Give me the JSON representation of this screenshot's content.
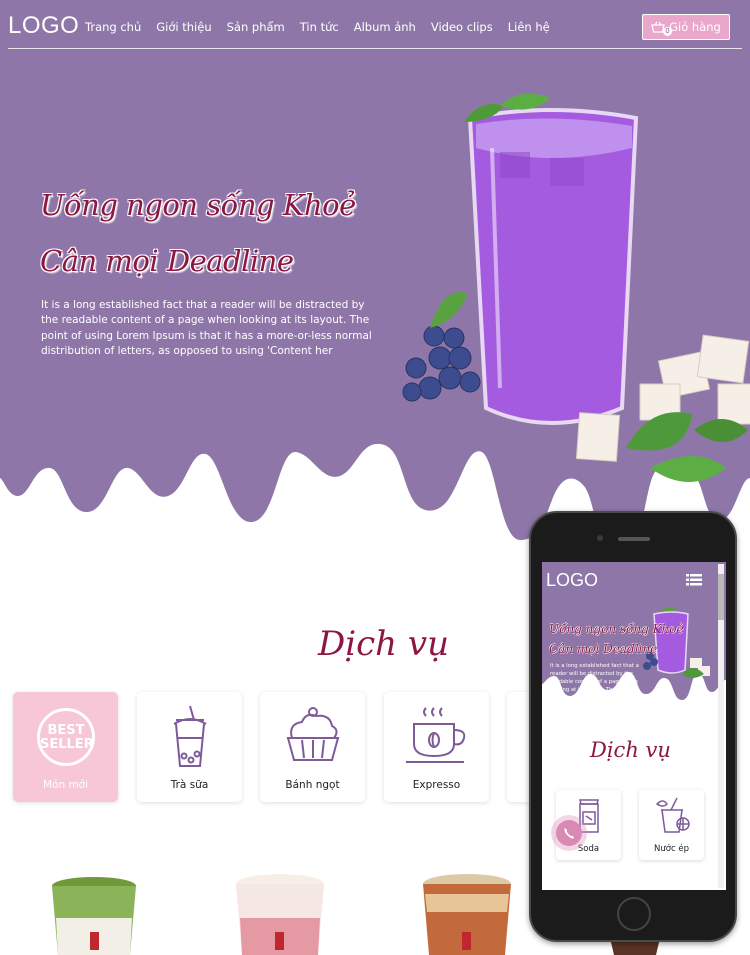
{
  "colors": {
    "hero_purple": "#8e77a8",
    "accent_pink": "#e9a7cb",
    "slogan_red": "#8c1743",
    "card_active": "#f8c7d7"
  },
  "header": {
    "logo": "LOGO",
    "menu": [
      "Trang chủ",
      "Giới thiệu",
      "Sản phẩm",
      "Tin tức",
      "Album ảnh",
      "Video clips",
      "Liên hệ"
    ],
    "cart_label": "Giỏ hàng",
    "cart_count": "0",
    "cart_icon": "basket-icon"
  },
  "hero": {
    "slogan_line1": "Uống ngon sống Khoẻ",
    "slogan_line2": "Cân mọi Deadline",
    "intro": "It is a long established fact that a reader will be distracted by the readable content of a page when looking at its layout. The point of using Lorem Ipsum is that it has a more-or-less normal distribution of letters, as opposed to using 'Content her"
  },
  "services": {
    "title": "Dịch vụ",
    "badge_line1": "BEST",
    "badge_line2": "SELLER",
    "items": [
      {
        "label": "Món mới",
        "icon": "best-seller-badge-icon"
      },
      {
        "label": "Trà sữa",
        "icon": "bubble-tea-icon"
      },
      {
        "label": "Bánh ngọt",
        "icon": "cupcake-icon"
      },
      {
        "label": "Expresso",
        "icon": "coffee-cup-icon"
      }
    ]
  },
  "mobile_preview": {
    "logo": "LOGO",
    "menu_icon": "hamburger-menu-icon",
    "slogan_line1": "Uống ngon sống Khoẻ",
    "slogan_line2": "Cân mọi Deadline",
    "intro": "It is a long established fact that a reader will be distracted by the readable content of a page when looking at its layout. The",
    "services_title": "Dịch vụ",
    "items": [
      {
        "label": "Soda",
        "icon": "soda-can-icon"
      },
      {
        "label": "Nước ép",
        "icon": "juice-icon"
      }
    ],
    "call_icon": "phone-call-icon"
  }
}
